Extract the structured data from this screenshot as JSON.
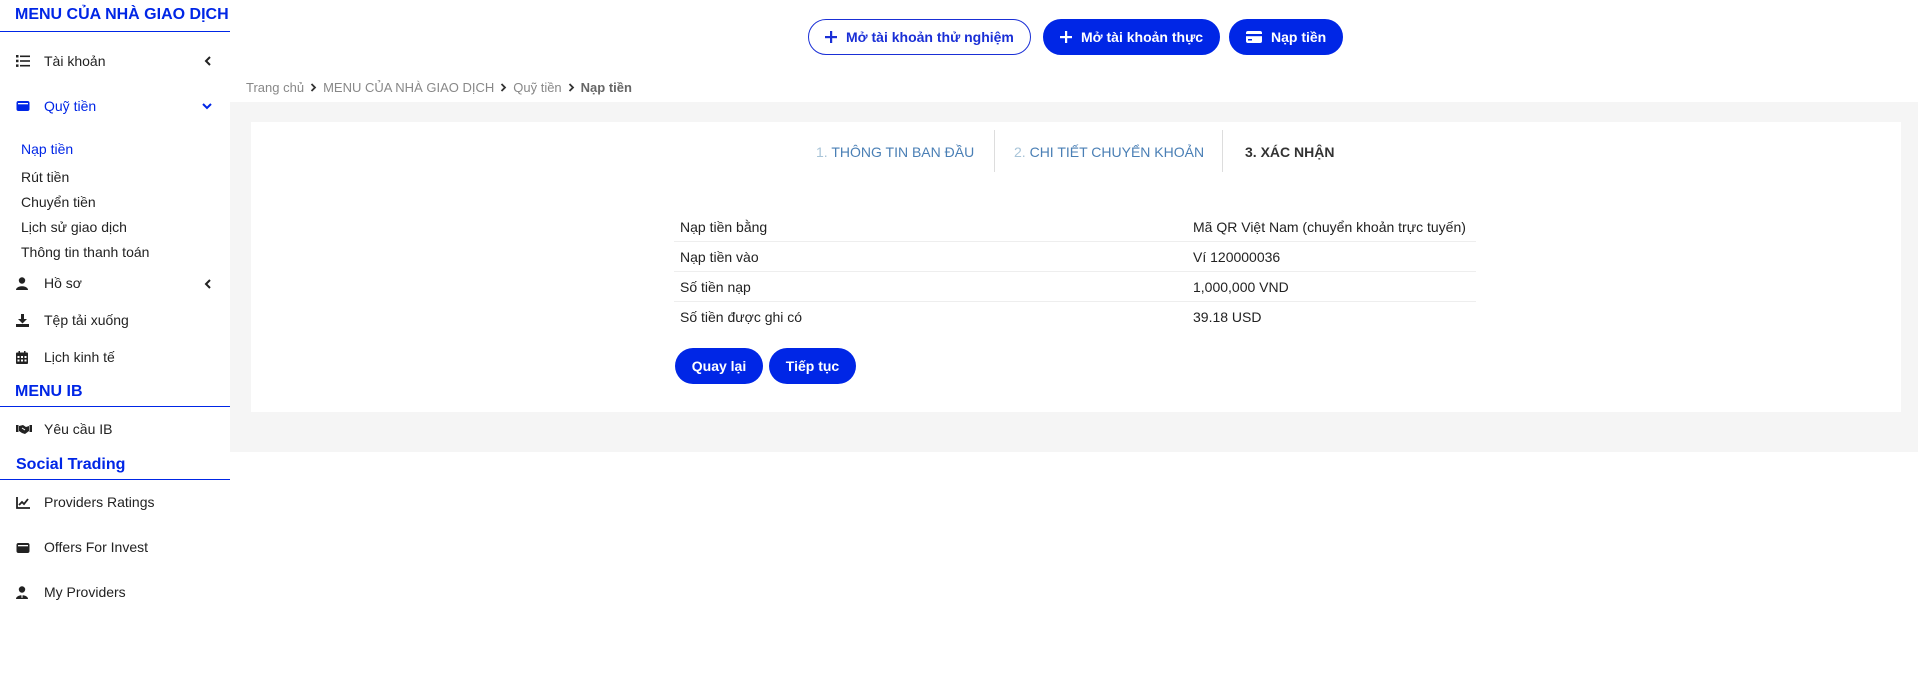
{
  "sidebar": {
    "trader_menu_title": "MENU CỦA NHÀ GIAO DỊCH",
    "items": {
      "account": "Tài khoản",
      "funds": "Quỹ tiền",
      "profile": "Hồ sơ",
      "downloads": "Tệp tải xuống",
      "calendar": "Lịch kinh tế",
      "ib_request": "Yêu cầu IB",
      "providers_ratings": "Providers Ratings",
      "offers_for_invest": "Offers For Invest",
      "my_providers": "My Providers"
    },
    "funds_sub": [
      "Nạp tiền",
      "Rút tiền",
      "Chuyển tiền",
      "Lịch sử giao dịch",
      "Thông tin thanh toán"
    ],
    "ib_menu_title": "MENU IB",
    "social_title": "Social Trading"
  },
  "topbar": {
    "demo_account": "Mở tài khoản thử nghiệm",
    "real_account": "Mở tài khoản thực",
    "deposit": "Nạp tiền"
  },
  "breadcrumb": [
    "Trang chủ",
    "MENU CỦA NHÀ GIAO DỊCH",
    "Quỹ tiền",
    "Nạp tiền"
  ],
  "steps": [
    {
      "num": "1.",
      "label": "THÔNG TIN BAN ĐẦU"
    },
    {
      "num": "2.",
      "label": "CHI TIẾT CHUYỂN KHOẢN"
    },
    {
      "num": "3.",
      "label": "XÁC NHẬN"
    }
  ],
  "summary": [
    {
      "label": "Nạp tiền bằng",
      "value": "Mã QR Việt Nam (chuyển khoản trực tuyến)"
    },
    {
      "label": "Nạp tiền vào",
      "value": "Ví 120000036"
    },
    {
      "label": "Số tiền nạp",
      "value": "1,000,000 VND"
    },
    {
      "label": "Số tiền được ghi có",
      "value": "39.18 USD"
    }
  ],
  "actions": {
    "back": "Quay lại",
    "continue": "Tiếp tục"
  },
  "colors": {
    "accent": "#0026e6",
    "step_link": "#4a7fb5",
    "content_bg": "#f5f5f5"
  }
}
